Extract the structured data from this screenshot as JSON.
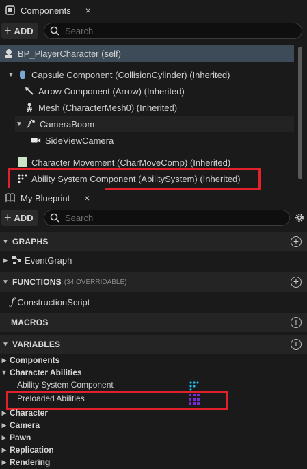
{
  "components_panel": {
    "tab_title": "Components",
    "close_label": "×",
    "add_label": "ADD",
    "search_placeholder": "Search",
    "root": "BP_PlayerCharacter (self)",
    "items": [
      {
        "label": "Capsule Component (CollisionCylinder) (Inherited)"
      },
      {
        "label": "Arrow Component (Arrow) (Inherited)"
      },
      {
        "label": "Mesh (CharacterMesh0) (Inherited)"
      },
      {
        "label": "CameraBoom"
      },
      {
        "label": "SideViewCamera"
      },
      {
        "label": "Character Movement (CharMoveComp) (Inherited)"
      },
      {
        "label": "Ability System Component (AbilitySystem) (Inherited)"
      }
    ]
  },
  "blueprint_panel": {
    "tab_title": "My Blueprint",
    "close_label": "×",
    "add_label": "ADD",
    "search_placeholder": "Search",
    "sections": {
      "graphs": "GRAPHS",
      "functions": "FUNCTIONS",
      "functions_sub": "(34 OVERRIDABLE)",
      "macros": "MACROS",
      "variables": "VARIABLES"
    },
    "event_graph": "EventGraph",
    "construction_script": "ConstructionScript",
    "categories": {
      "components": "Components",
      "character_abilities": "Character Abilities",
      "character": "Character",
      "camera": "Camera",
      "pawn": "Pawn",
      "replication": "Replication",
      "rendering": "Rendering"
    },
    "variables": {
      "ability_system_component": "Ability System Component",
      "preloaded_abilities": "Preloaded Abilities"
    }
  },
  "colors": {
    "highlight": "#e1212b",
    "selected_row": "#3d4a58",
    "var_type_cyan": "#1fb6e8",
    "var_type_purple": "#7a2bd6"
  }
}
